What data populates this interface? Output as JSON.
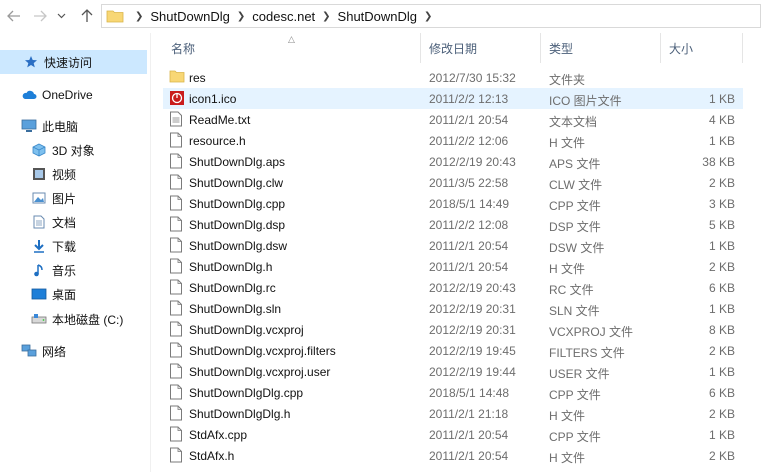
{
  "address": {
    "crumbs": [
      "ShutDownDlg",
      "codesc.net",
      "ShutDownDlg"
    ]
  },
  "sidebar": {
    "items": [
      {
        "label": "快速访问",
        "icon": "star-icon"
      },
      {
        "label": "OneDrive",
        "icon": "cloud-icon"
      },
      {
        "label": "此电脑",
        "icon": "computer-icon"
      },
      {
        "label": "3D 对象",
        "icon": "3d-objects-icon"
      },
      {
        "label": "视频",
        "icon": "video-icon"
      },
      {
        "label": "图片",
        "icon": "pictures-icon"
      },
      {
        "label": "文档",
        "icon": "documents-icon"
      },
      {
        "label": "下载",
        "icon": "download-icon"
      },
      {
        "label": "音乐",
        "icon": "music-icon"
      },
      {
        "label": "桌面",
        "icon": "desktop-icon"
      },
      {
        "label": "本地磁盘 (C:)",
        "icon": "drive-icon"
      },
      {
        "label": "网络",
        "icon": "network-icon"
      }
    ]
  },
  "columns": {
    "name": "名称",
    "date": "修改日期",
    "type": "类型",
    "size": "大小"
  },
  "files": [
    {
      "name": "res",
      "date": "2012/7/30 15:32",
      "type": "文件夹",
      "size": "",
      "icon": "folder-icon"
    },
    {
      "name": "icon1.ico",
      "date": "2011/2/2 12:13",
      "type": "ICO 图片文件",
      "size": "1 KB",
      "icon": "ico-file-icon"
    },
    {
      "name": "ReadMe.txt",
      "date": "2011/2/1 20:54",
      "type": "文本文档",
      "size": "4 KB",
      "icon": "text-file-icon"
    },
    {
      "name": "resource.h",
      "date": "2011/2/2 12:06",
      "type": "H 文件",
      "size": "1 KB",
      "icon": "file-icon"
    },
    {
      "name": "ShutDownDlg.aps",
      "date": "2012/2/19 20:43",
      "type": "APS 文件",
      "size": "38 KB",
      "icon": "file-icon"
    },
    {
      "name": "ShutDownDlg.clw",
      "date": "2011/3/5 22:58",
      "type": "CLW 文件",
      "size": "2 KB",
      "icon": "file-icon"
    },
    {
      "name": "ShutDownDlg.cpp",
      "date": "2018/5/1 14:49",
      "type": "CPP 文件",
      "size": "3 KB",
      "icon": "file-icon"
    },
    {
      "name": "ShutDownDlg.dsp",
      "date": "2011/2/2 12:08",
      "type": "DSP 文件",
      "size": "5 KB",
      "icon": "file-icon"
    },
    {
      "name": "ShutDownDlg.dsw",
      "date": "2011/2/1 20:54",
      "type": "DSW 文件",
      "size": "1 KB",
      "icon": "file-icon"
    },
    {
      "name": "ShutDownDlg.h",
      "date": "2011/2/1 20:54",
      "type": "H 文件",
      "size": "2 KB",
      "icon": "file-icon"
    },
    {
      "name": "ShutDownDlg.rc",
      "date": "2012/2/19 20:43",
      "type": "RC 文件",
      "size": "6 KB",
      "icon": "file-icon"
    },
    {
      "name": "ShutDownDlg.sln",
      "date": "2012/2/19 20:31",
      "type": "SLN 文件",
      "size": "1 KB",
      "icon": "file-icon"
    },
    {
      "name": "ShutDownDlg.vcxproj",
      "date": "2012/2/19 20:31",
      "type": "VCXPROJ 文件",
      "size": "8 KB",
      "icon": "file-icon"
    },
    {
      "name": "ShutDownDlg.vcxproj.filters",
      "date": "2012/2/19 19:45",
      "type": "FILTERS 文件",
      "size": "2 KB",
      "icon": "file-icon"
    },
    {
      "name": "ShutDownDlg.vcxproj.user",
      "date": "2012/2/19 19:44",
      "type": "USER 文件",
      "size": "1 KB",
      "icon": "file-icon"
    },
    {
      "name": "ShutDownDlgDlg.cpp",
      "date": "2018/5/1 14:48",
      "type": "CPP 文件",
      "size": "6 KB",
      "icon": "file-icon"
    },
    {
      "name": "ShutDownDlgDlg.h",
      "date": "2011/2/1 21:18",
      "type": "H 文件",
      "size": "2 KB",
      "icon": "file-icon"
    },
    {
      "name": "StdAfx.cpp",
      "date": "2011/2/1 20:54",
      "type": "CPP 文件",
      "size": "1 KB",
      "icon": "file-icon"
    },
    {
      "name": "StdAfx.h",
      "date": "2011/2/1 20:54",
      "type": "H 文件",
      "size": "2 KB",
      "icon": "file-icon"
    }
  ],
  "colors": {
    "selected_bg": "#cce8ff",
    "hover_bg": "#e5f3ff",
    "header_text": "#4c607a",
    "folder_yellow": "#f8d775",
    "star_blue": "#2b6fc4"
  }
}
